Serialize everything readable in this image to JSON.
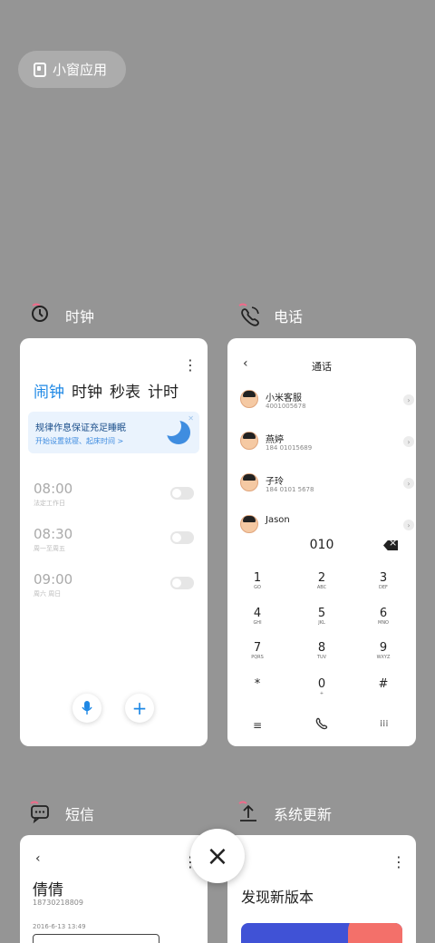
{
  "small_window": {
    "label": "小窗应用",
    "icon": "small-window-icon"
  },
  "apps": {
    "clock": {
      "name": "时钟",
      "icon": "clock-icon",
      "tabs": [
        "闹钟",
        "时钟",
        "秒表",
        "计时"
      ],
      "active_tab": "闹钟",
      "banner": {
        "title": "规律作息保证充足睡眠",
        "subtitle": "开始设置就寝、起床时间 >"
      },
      "alarms": [
        {
          "time": "08:00",
          "desc": "法定工作日",
          "enabled": false
        },
        {
          "time": "08:30",
          "desc": "周一至周五",
          "enabled": false
        },
        {
          "time": "09:00",
          "desc": "周六 周日",
          "enabled": false
        }
      ],
      "voice_icon": "microphone-icon",
      "add_label": "+"
    },
    "phone": {
      "name": "电话",
      "icon": "phone-icon",
      "title": "通话",
      "back": "‹",
      "contacts": [
        {
          "name": "小米客服",
          "number": "4001005678"
        },
        {
          "name": "燕婷",
          "number": "184 01015689"
        },
        {
          "name": "子玲",
          "number": "184 0101 5678"
        },
        {
          "name": "Jason",
          "number": ""
        }
      ],
      "dialed": "010",
      "keys": [
        {
          "num": "1",
          "sub": "GO"
        },
        {
          "num": "2",
          "sub": "ABC"
        },
        {
          "num": "3",
          "sub": "DEF"
        },
        {
          "num": "4",
          "sub": "GHI"
        },
        {
          "num": "5",
          "sub": "JKL"
        },
        {
          "num": "6",
          "sub": "MNO"
        },
        {
          "num": "7",
          "sub": "PQRS"
        },
        {
          "num": "8",
          "sub": "TUV"
        },
        {
          "num": "9",
          "sub": "WXYZ"
        },
        {
          "num": "*",
          "sub": ""
        },
        {
          "num": "0",
          "sub": "+"
        },
        {
          "num": "#",
          "sub": ""
        }
      ],
      "bottom": {
        "menu": "≡",
        "call_icon": "phone-call-icon",
        "keypad": "⁞⁞⁞"
      }
    },
    "sms": {
      "name": "短信",
      "icon": "message-icon",
      "back": "‹",
      "contact_name": "倩倩",
      "contact_number": "18730218809",
      "date": "2016-6-13 13:49"
    },
    "update": {
      "name": "系统更新",
      "icon": "upload-icon",
      "title": "发现新版本"
    }
  },
  "close_button": "×"
}
